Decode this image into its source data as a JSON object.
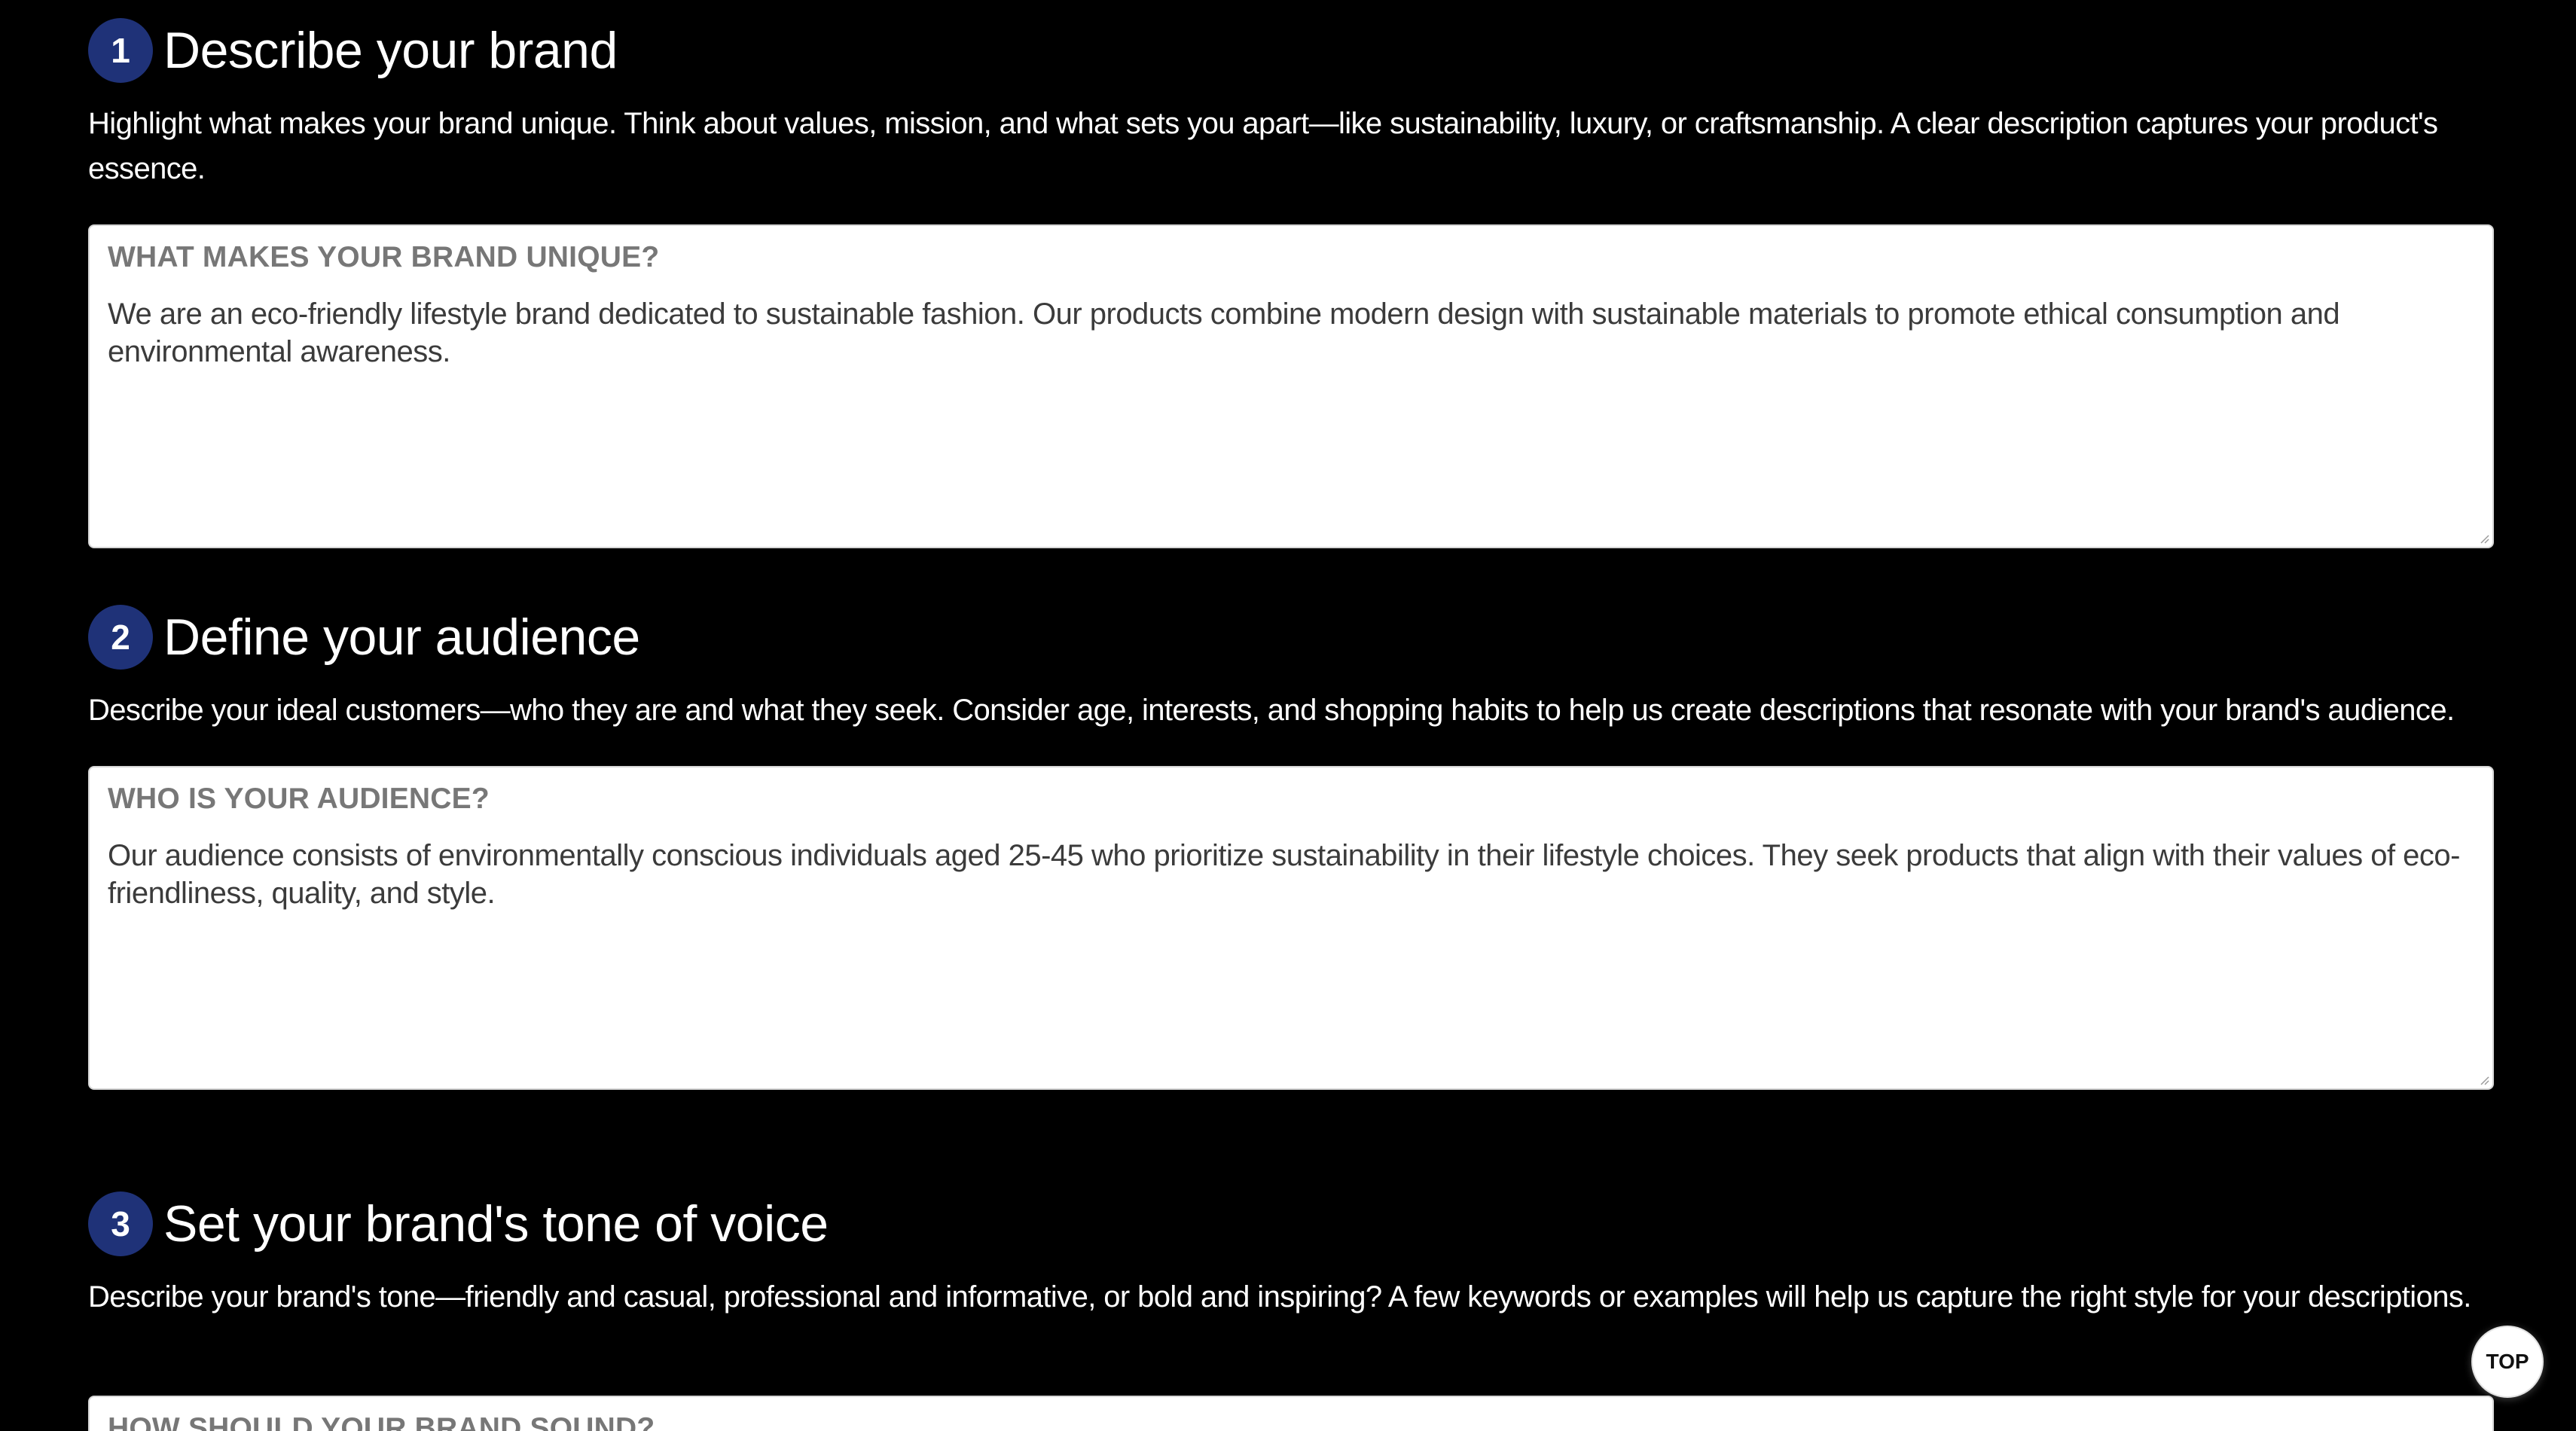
{
  "sections": [
    {
      "number": "1",
      "title": "Describe your brand",
      "description": "Highlight what makes your brand unique. Think about values, mission, and what sets you apart—like sustainability, luxury, or craftsmanship. A clear description captures your product's essence.",
      "field_label": "WHAT MAKES YOUR BRAND UNIQUE?",
      "field_value": "We are an eco-friendly lifestyle brand dedicated to sustainable fashion. Our products combine modern design with sustainable materials to promote ethical consumption and environmental awareness."
    },
    {
      "number": "2",
      "title": "Define your audience",
      "description": "Describe your ideal customers—who they are and what they seek. Consider age, interests, and shopping habits to help us create descriptions that resonate with your brand's audience.",
      "field_label": "WHO IS YOUR AUDIENCE?",
      "field_value": "Our audience consists of environmentally conscious individuals aged 25-45 who prioritize sustainability in their lifestyle choices. They seek products that align with their values of eco-friendliness, quality, and style."
    },
    {
      "number": "3",
      "title": "Set your brand's tone of voice",
      "description": "Describe your brand's tone—friendly and casual, professional and informative, or bold and inspiring? A few keywords or examples will help us capture the right style for your descriptions.",
      "field_label": "HOW SHOULD YOUR BRAND SOUND?",
      "field_value": ""
    }
  ],
  "top_button": {
    "label": "TOP"
  },
  "colors": {
    "background": "#000000",
    "badge": "#1f3278",
    "field_label": "#777777",
    "field_text": "#3b3b3b"
  }
}
